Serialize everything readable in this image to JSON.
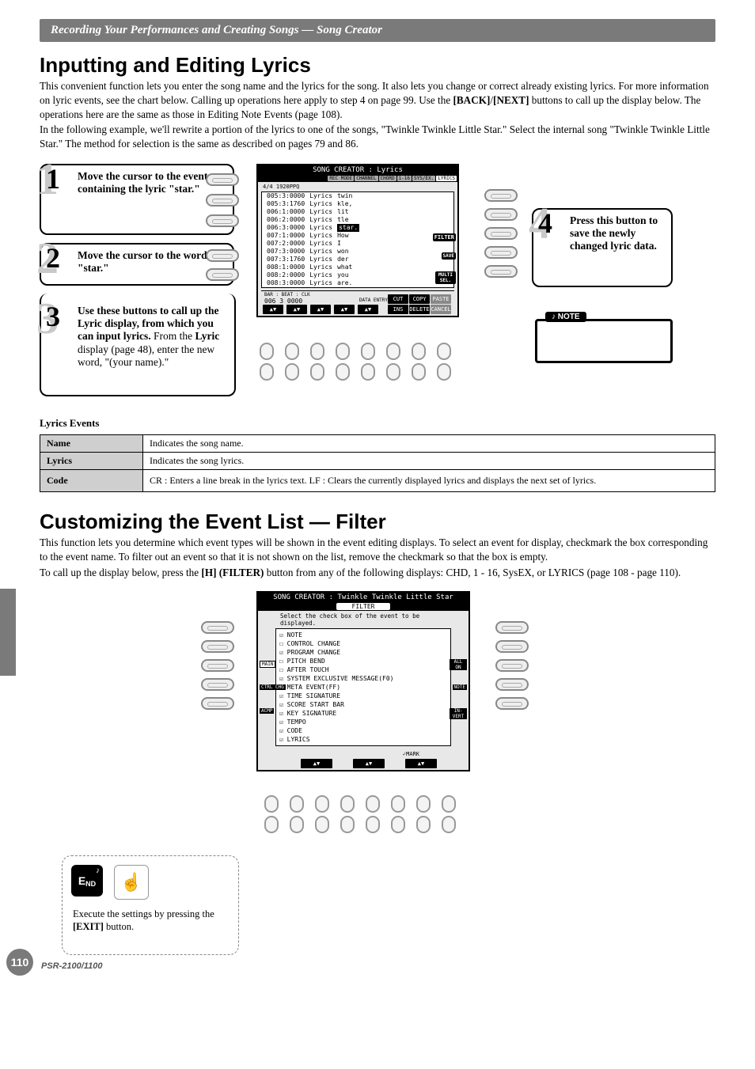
{
  "header": {
    "title": "Recording Your Performances and Creating Songs — Song Creator"
  },
  "section1": {
    "title": "Inputting and Editing Lyrics",
    "para1_a": "This convenient function lets you enter the song name and the lyrics for the song. It also lets you change or correct already existing lyrics. For more information on lyric events, see the chart below. Calling up operations here apply to step 4 on page 99. Use the ",
    "para1_b": "[BACK]",
    "para1_c": "/",
    "para1_d": "[NEXT]",
    "para1_e": " buttons to call up the display below. The operations here are the same as those in Editing Note Events (page 108).",
    "para2": "In the following example, we'll rewrite a portion of the lyrics to one of the songs, \"Twinkle Twinkle Little Star.\" Select the internal song \"Twinkle Twinkle Little Star.\" The method for selection is the same as described on pages 79 and 86."
  },
  "steps": {
    "s1": {
      "num": "1",
      "text_a": "Move the cursor to the event containing the lyric \"star.\""
    },
    "s2": {
      "num": "2",
      "text_a": "Move the cursor to the word \"star.\""
    },
    "s3": {
      "num": "3",
      "bold": "Use these buttons to call up the Lyric display, from which you can input lyrics.",
      "plain_a": "From the ",
      "plain_b": "Lyric",
      "plain_c": " display (page 48), enter the new word, \"(your name).\""
    },
    "s4": {
      "num": "4",
      "text": "Press this button to save the newly changed lyric data."
    }
  },
  "screen1": {
    "title": "SONG CREATOR : Lyrics",
    "tabs": [
      "REC MODE",
      "CHANNEL",
      "CHORD",
      "1-16",
      "SYS/EX.",
      "LYRICS"
    ],
    "meta": "4/4     1920PPQ",
    "rows": [
      [
        "005:3:0000",
        "Lyrics",
        "twin"
      ],
      [
        "005:3:1760",
        "Lyrics",
        "kle,"
      ],
      [
        "006:1:0000",
        "Lyrics",
        "lit"
      ],
      [
        "006:2:0000",
        "Lyrics",
        "tle"
      ],
      [
        "006:3:0000",
        "Lyrics",
        "star."
      ],
      [
        "007:1:0000",
        "Lyrics",
        "How"
      ],
      [
        "007:2:0000",
        "Lyrics",
        "I"
      ],
      [
        "007:3:0000",
        "Lyrics",
        "won"
      ],
      [
        "007:3:1760",
        "Lyrics",
        "der"
      ],
      [
        "008:1:0000",
        "Lyrics",
        "what"
      ],
      [
        "008:2:0000",
        "Lyrics",
        "you"
      ],
      [
        "008:3:0000",
        "Lyrics",
        "are."
      ]
    ],
    "side": {
      "filter": "FILTER",
      "save": "SAVE",
      "multi": "MULTI SEL."
    },
    "footer_pos": "BAR : BEAT : CLK",
    "footer_vals": "006    3    0000",
    "data_entry": "DATA ENTRY",
    "btns": [
      "CUT",
      "COPY",
      "PASTE",
      "INS",
      "DELETE",
      "CANCEL"
    ]
  },
  "events": {
    "title": "Lyrics Events",
    "rows": [
      {
        "name": "Name",
        "desc": "Indicates the song name."
      },
      {
        "name": "Lyrics",
        "desc": "Indicates the song lyrics."
      },
      {
        "name": "Code",
        "desc": "CR : Enters a line break in the lyrics text.   LF : Clears the currently displayed lyrics and displays the next set of lyrics."
      }
    ]
  },
  "section2": {
    "title": "Customizing the Event List — Filter",
    "para1": "This function lets you determine which event types will be shown in the event editing displays. To select an event for display, checkmark the box corresponding to the event name. To filter out an event so that it is not shown on the list, remove the checkmark so that the box is empty.",
    "para2_a": "To call up the display below, press the ",
    "para2_b": "[H] (FILTER)",
    "para2_c": " button from any of the following displays: CHD, 1 - 16, SysEX, or LYRICS (page 108 - page 110)."
  },
  "screen2": {
    "title": "SONG CREATOR : Twinkle Twinkle Little Star",
    "filter_tab": "FILTER",
    "instr": "Select the check box of the event to be displayed.",
    "items": [
      "☑ NOTE",
      "☐ CONTROL CHANGE",
      "☑ PROGRAM CHANGE",
      "☐ PITCH BEND",
      "☐ AFTER TOUCH",
      "☑ SYSTEM EXCLUSIVE MESSAGE(F0)",
      "☑ META EVENT(FF)",
      "☑ TIME SIGNATURE",
      "☑ SCORE START BAR",
      "☑ KEY SIGNATURE",
      "☑ TEMPO",
      "☑ CODE",
      "☑ LYRICS"
    ],
    "left_labels": [
      "MAIN",
      "CTRL CHG",
      "ACMP"
    ],
    "right_labels": [
      "ALL ON",
      "NOTE",
      "IN-VERT"
    ],
    "mark": "✓MARK"
  },
  "end": {
    "text_a": "Execute the settings by pressing the ",
    "text_b": "[EXIT]",
    "text_c": " button."
  },
  "footer": {
    "page": "110",
    "model": "PSR-2100/1100"
  },
  "note_label": "NOTE"
}
